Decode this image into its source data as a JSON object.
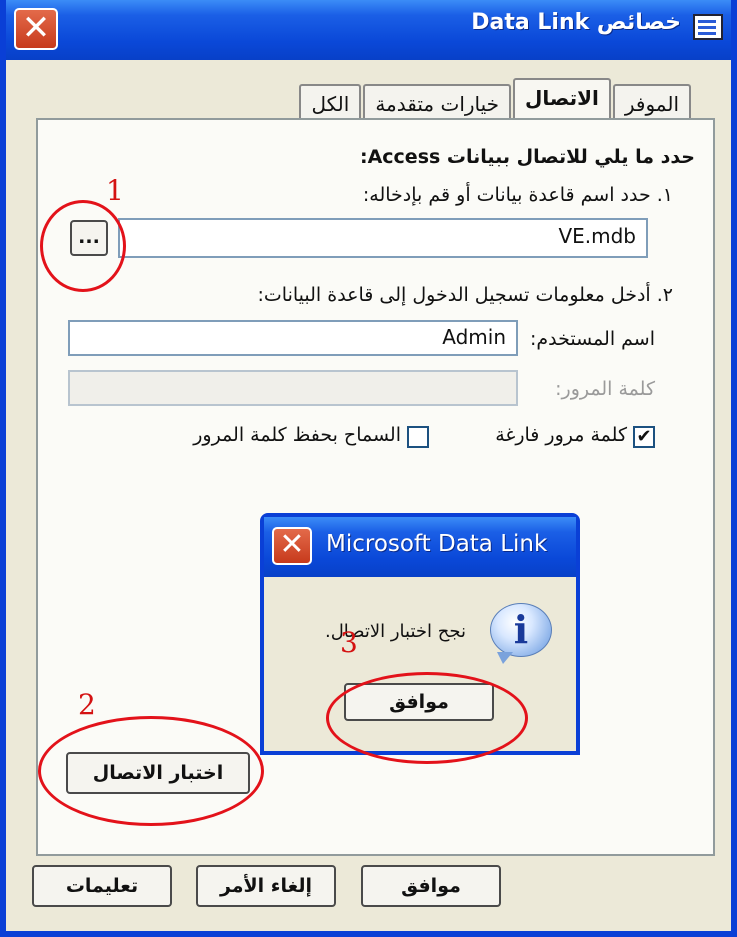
{
  "window": {
    "title": "خصائص Data Link",
    "close_symbol": "✕",
    "tabs": [
      "الموفر",
      "الاتصال",
      "خيارات متقدمة",
      "الكل"
    ],
    "active_tab_index": 1
  },
  "connection": {
    "intro": "حدد ما يلي للاتصال ببيانات Access:",
    "step1_label": "١. حدد اسم قاعدة بيانات أو قم بإدخاله:",
    "database_value": "VE.mdb",
    "browse_label": "...",
    "step2_label": "٢. أدخل معلومات تسجيل الدخول إلى قاعدة البيانات:",
    "username_label": "اسم المستخدم:",
    "username_value": "Admin",
    "password_label": "كلمة المرور:",
    "password_value": "",
    "blank_password_label": "كلمة مرور فارغة",
    "blank_password_checked": true,
    "check_mark": "✔",
    "allow_save_label": "السماح بحفظ كلمة المرور",
    "allow_save_checked": false,
    "test_button_label": "اختبار الاتصال"
  },
  "footer": {
    "ok_label": "موافق",
    "cancel_label": "إلغاء الأمر",
    "help_label": "تعليمات"
  },
  "message_box": {
    "title": "Microsoft Data Link",
    "close_symbol": "✕",
    "icon_glyph": "i",
    "message": "نجح اختبار الاتصال.",
    "ok_label": "موافق"
  },
  "annotations": {
    "labels": [
      "1",
      "2",
      "3"
    ],
    "color": "#e3121a"
  },
  "colors": {
    "titlebar": "#0a48d8",
    "window_bg": "#ece9d8",
    "close_button": "#c73a1c",
    "annotation_red": "#e3121a"
  }
}
